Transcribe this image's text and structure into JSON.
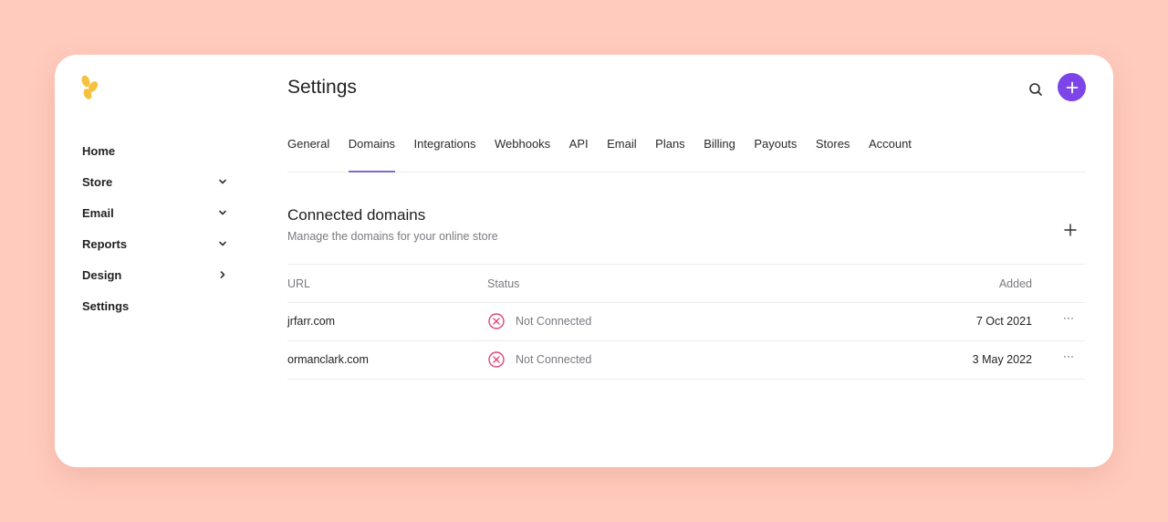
{
  "sidebar": {
    "items": [
      {
        "label": "Home"
      },
      {
        "label": "Store"
      },
      {
        "label": "Email"
      },
      {
        "label": "Reports"
      },
      {
        "label": "Design"
      },
      {
        "label": "Settings"
      }
    ]
  },
  "header": {
    "title": "Settings"
  },
  "tabs": [
    {
      "label": "General"
    },
    {
      "label": "Domains",
      "active": true
    },
    {
      "label": "Integrations"
    },
    {
      "label": "Webhooks"
    },
    {
      "label": "API"
    },
    {
      "label": "Email"
    },
    {
      "label": "Plans"
    },
    {
      "label": "Billing"
    },
    {
      "label": "Payouts"
    },
    {
      "label": "Stores"
    },
    {
      "label": "Account"
    }
  ],
  "section": {
    "title": "Connected domains",
    "subtitle": "Manage the domains for your online store"
  },
  "table": {
    "columns": {
      "url": "URL",
      "status": "Status",
      "added": "Added"
    },
    "rows": [
      {
        "url": "jrfarr.com",
        "status": "Not Connected",
        "added": "7 Oct 2021",
        "more": "···"
      },
      {
        "url": "ormanclark.com",
        "status": "Not Connected",
        "added": "3 May 2022",
        "more": "···"
      }
    ]
  },
  "colors": {
    "background": "#ffcbbd",
    "accent": "#7b45e8",
    "error": "#e0457b",
    "logo": "#f6c23e"
  },
  "icons": [
    "logo-icon",
    "search-icon",
    "plus-icon",
    "chevron-down-icon",
    "chevron-right-icon",
    "x-circle-icon",
    "more-icon"
  ]
}
